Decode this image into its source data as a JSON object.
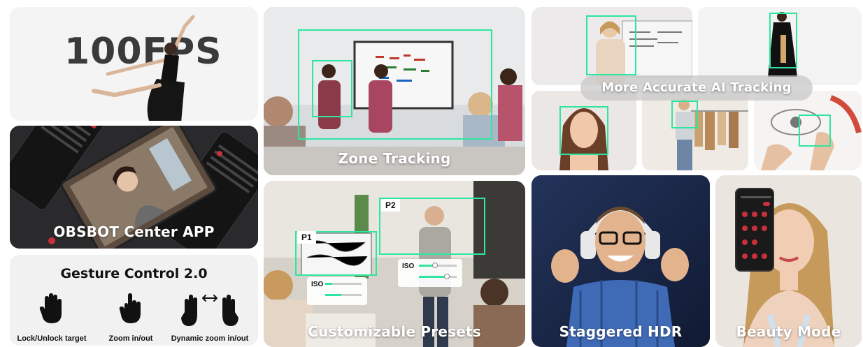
{
  "tiles": {
    "fps": {
      "headline": "100FPS"
    },
    "app": {
      "caption": "OBSBOT Center APP"
    },
    "gesture": {
      "title": "Gesture Control 2.0",
      "items": [
        {
          "label": "Lock/Unlock target",
          "icon": "raised-hand-icon"
        },
        {
          "label": "Zoom in/out",
          "icon": "pointing-hand-icon"
        },
        {
          "label": "Dynamic zoom in/out",
          "icon": "two-hands-zoom-icon"
        }
      ]
    },
    "zone": {
      "caption": "Zone Tracking"
    },
    "ai": {
      "caption": "More Accurate AI Tracking"
    },
    "presets": {
      "caption": "Customizable Presets",
      "p1_label": "P1",
      "p2_label": "P2",
      "iso_label_1": "ISO",
      "iso_label_2": "ISO"
    },
    "hdr": {
      "caption": "Staggered HDR"
    },
    "beauty": {
      "caption": "Beauty Mode"
    }
  },
  "colors": {
    "tracking_green": "#2ee6a0",
    "caption_text": "#ffffff",
    "app_dark": "#1c1c1e"
  }
}
